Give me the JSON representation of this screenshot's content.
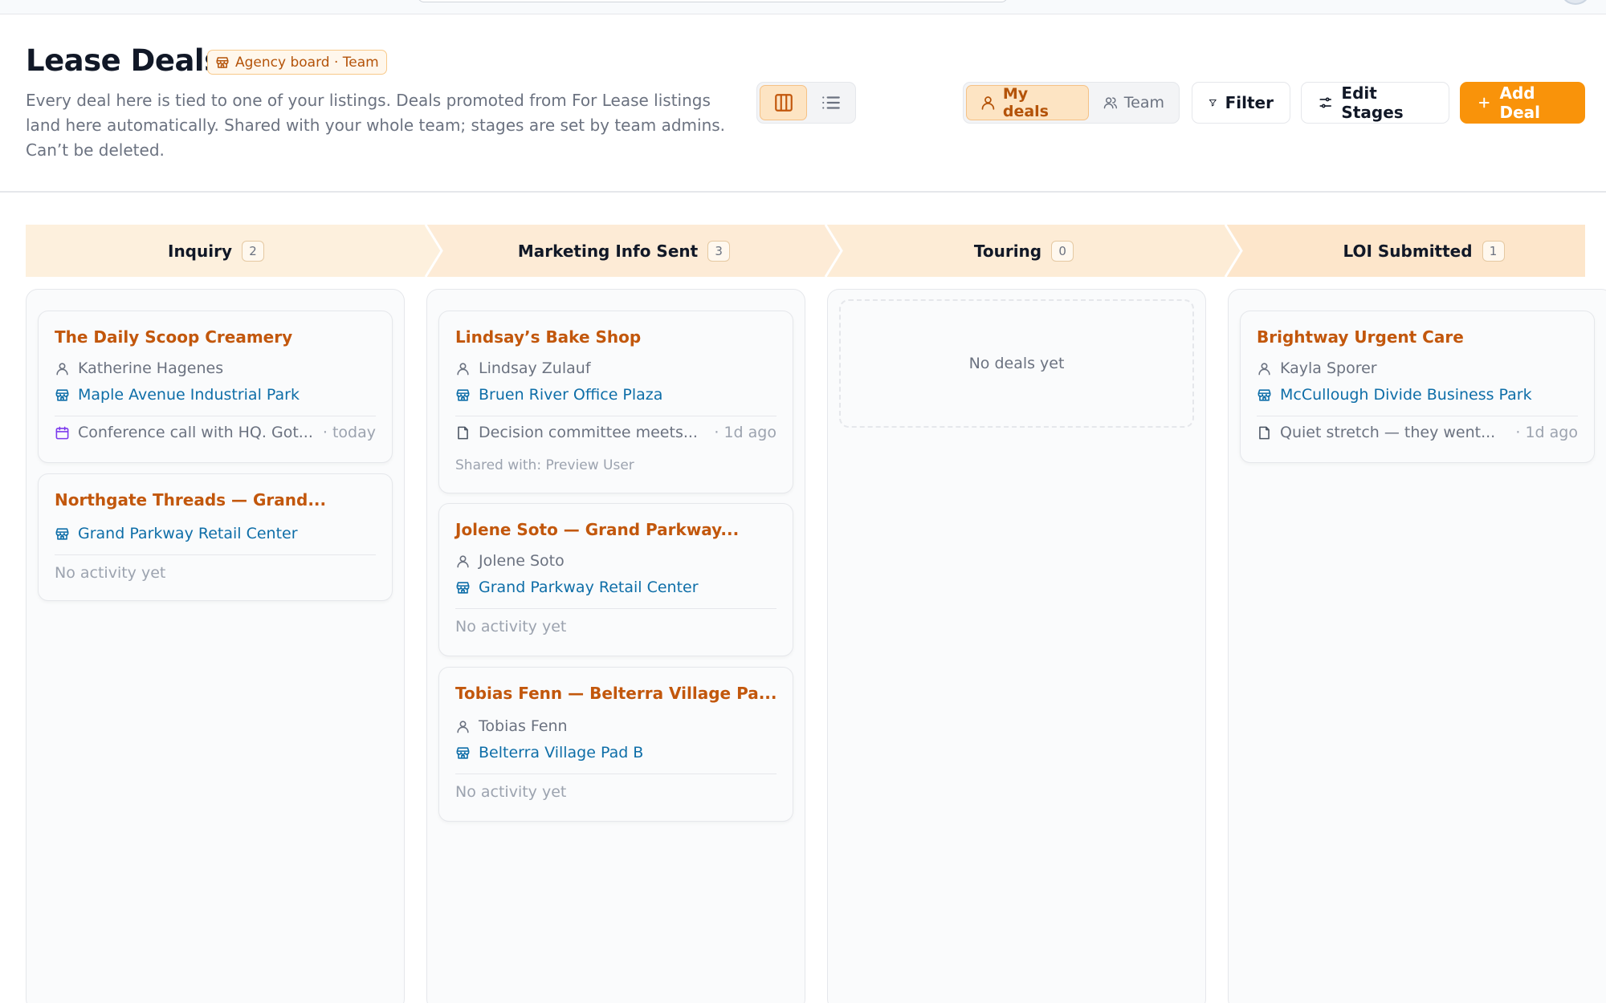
{
  "header": {
    "title": "Lease Deals",
    "badge": "Agency board · Team",
    "description": "Every deal here is tied to one of your listings. Deals promoted from For Lease listings land here automatically. Shared with your whole team; stages are set by team admins. Can’t be deleted."
  },
  "toolbar": {
    "scope": {
      "mine": "My deals",
      "team": "Team",
      "selected": "My deals"
    },
    "view_mode": "board",
    "filter": "Filter",
    "edit_stages": "Edit Stages",
    "add_deal": "Add Deal"
  },
  "colors": {
    "accent": "#f9930a",
    "deal_title": "#c2570c",
    "listing_link": "#0e6ea8",
    "stage_bg": "#fdebd3"
  },
  "stages": [
    {
      "name": "Inquiry",
      "count": "2",
      "deals": [
        {
          "title": "The Daily Scoop Creamery",
          "contact": "Katherine Hagenes",
          "listing": "Maple Avenue Industrial Park",
          "activity_icon": "calendar-icon",
          "activity": "Conference call with HQ. Got...",
          "activity_time": "· today"
        },
        {
          "title": "Northgate Threads — Grand...",
          "listing": "Grand Parkway Retail Center",
          "no_activity": "No activity yet"
        }
      ]
    },
    {
      "name": "Marketing Info Sent",
      "count": "3",
      "deals": [
        {
          "title": "Lindsay’s Bake Shop",
          "contact": "Lindsay Zulauf",
          "listing": "Bruen River Office Plaza",
          "activity_icon": "note-icon",
          "activity": "Decision committee meets...",
          "activity_time": "· 1d ago",
          "shared": "Shared with: Preview User"
        },
        {
          "title": "Jolene Soto — Grand Parkway...",
          "contact": "Jolene Soto",
          "listing": "Grand Parkway Retail Center",
          "no_activity": "No activity yet"
        },
        {
          "title": "Tobias Fenn — Belterra Village Pa...",
          "contact": "Tobias Fenn",
          "listing": "Belterra Village Pad B",
          "no_activity": "No activity yet"
        }
      ]
    },
    {
      "name": "Touring",
      "count": "0",
      "empty_text": "No deals yet",
      "deals": []
    },
    {
      "name": "LOI Submitted",
      "count": "1",
      "deals": [
        {
          "title": "Brightway Urgent Care",
          "contact": "Kayla Sporer",
          "listing": "McCullough Divide Business Park",
          "activity_icon": "note-icon",
          "activity": "Quiet stretch — they went...",
          "activity_time": "· 1d ago"
        }
      ]
    }
  ]
}
